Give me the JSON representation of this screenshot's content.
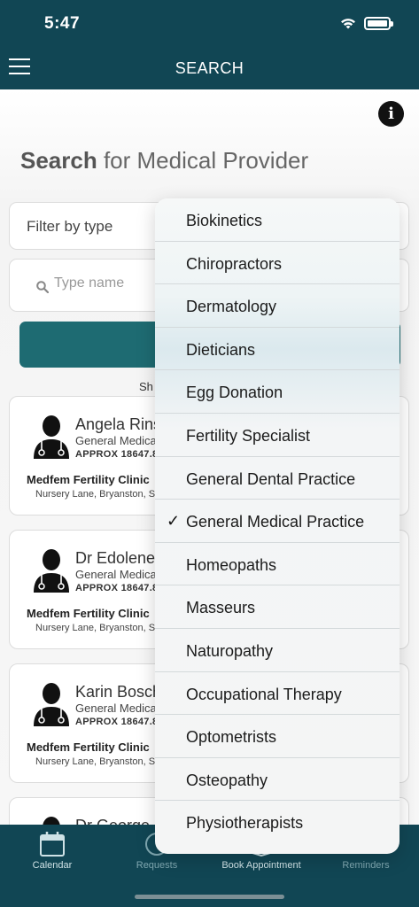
{
  "status_bar": {
    "time": "5:47"
  },
  "header": {
    "title": "SEARCH"
  },
  "page": {
    "title_bold": "Search",
    "title_rest": " for Medical Provider"
  },
  "filter": {
    "label": "Filter by type"
  },
  "name_search": {
    "placeholder": "Type name"
  },
  "results": {
    "showing_text": "Sh"
  },
  "providers": [
    {
      "name": "Angela Rins",
      "type": "General Medica",
      "distance": "APPROX 18647.8",
      "clinic": "Medfem Fertility Clinic",
      "address": "Nursery Lane, Bryanston, S"
    },
    {
      "name": "Dr Edolene",
      "type": "General Medica",
      "distance": "APPROX 18647.8",
      "clinic": "Medfem Fertility Clinic",
      "address": "Nursery Lane, Bryanston, S"
    },
    {
      "name": "Karin Bosch",
      "type": "General Medica",
      "distance": "APPROX 18647.8",
      "clinic": "Medfem Fertility Clinic",
      "address": "Nursery Lane, Bryanston, S"
    },
    {
      "name": "Dr George",
      "type": "",
      "distance": "",
      "clinic": "",
      "address": ""
    }
  ],
  "dropdown": {
    "selected": "General Medical Practice",
    "options": [
      "Biokinetics",
      "Chiropractors",
      "Dermatology",
      "Dieticians",
      "Egg Donation",
      "Fertility Specialist",
      "General Dental Practice",
      "General Medical Practice",
      "Homeopaths",
      "Masseurs",
      "Naturopathy",
      "Occupational Therapy",
      "Optometrists",
      "Osteopathy",
      "Physiotherapists"
    ],
    "check_glyph": "✓"
  },
  "tabs": [
    {
      "label": "Calendar",
      "icon": "calendar-icon"
    },
    {
      "label": "Requests",
      "icon": "clock-icon"
    },
    {
      "label": "Book Appointment",
      "icon": "book-icon"
    },
    {
      "label": "Reminders",
      "icon": "bell-icon"
    }
  ],
  "colors": {
    "header": "#114654",
    "accent": "#1e6b72",
    "tabbar": "#114654"
  }
}
